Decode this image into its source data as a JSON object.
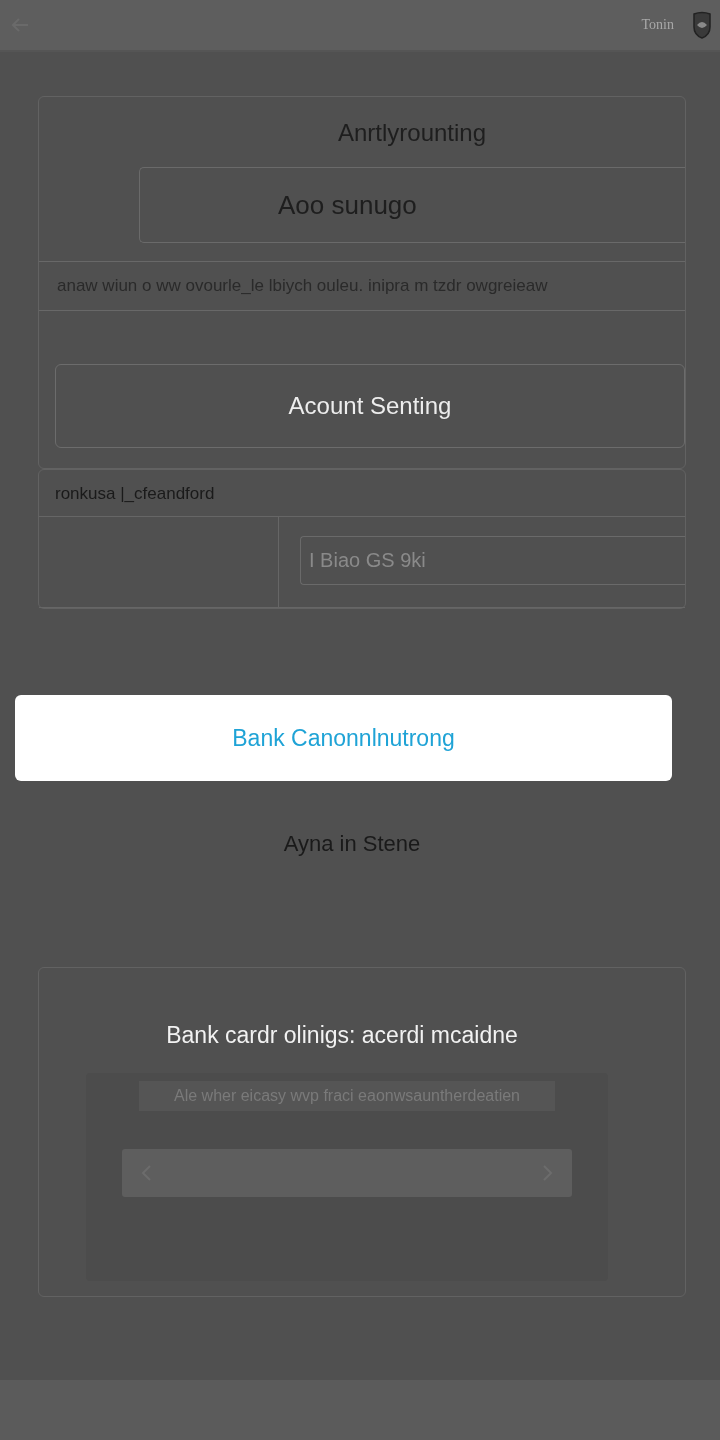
{
  "top_bar": {
    "brand": "Tonin"
  },
  "account_card": {
    "heading": "Anrtlyrounting",
    "field_value": "Aoo sunugo",
    "note": "anaw wiun o ww ovourle_le lbiych ouleu. inipra m tzdr owgreieaw",
    "button": "Acount Senting"
  },
  "detail_card": {
    "label": "ronkusa |_cfeandford",
    "field_value": "I Biao GS 9ki"
  },
  "sheet": {
    "button": "Bank Canonnlnutrong"
  },
  "section_title": "Ayna in Stene",
  "bank_card": {
    "title": "Bank cardr olinigs: acerdi mcaidne",
    "hint": "Ale wher eicasy wvp fraci eaonwsauntherdeatien"
  }
}
